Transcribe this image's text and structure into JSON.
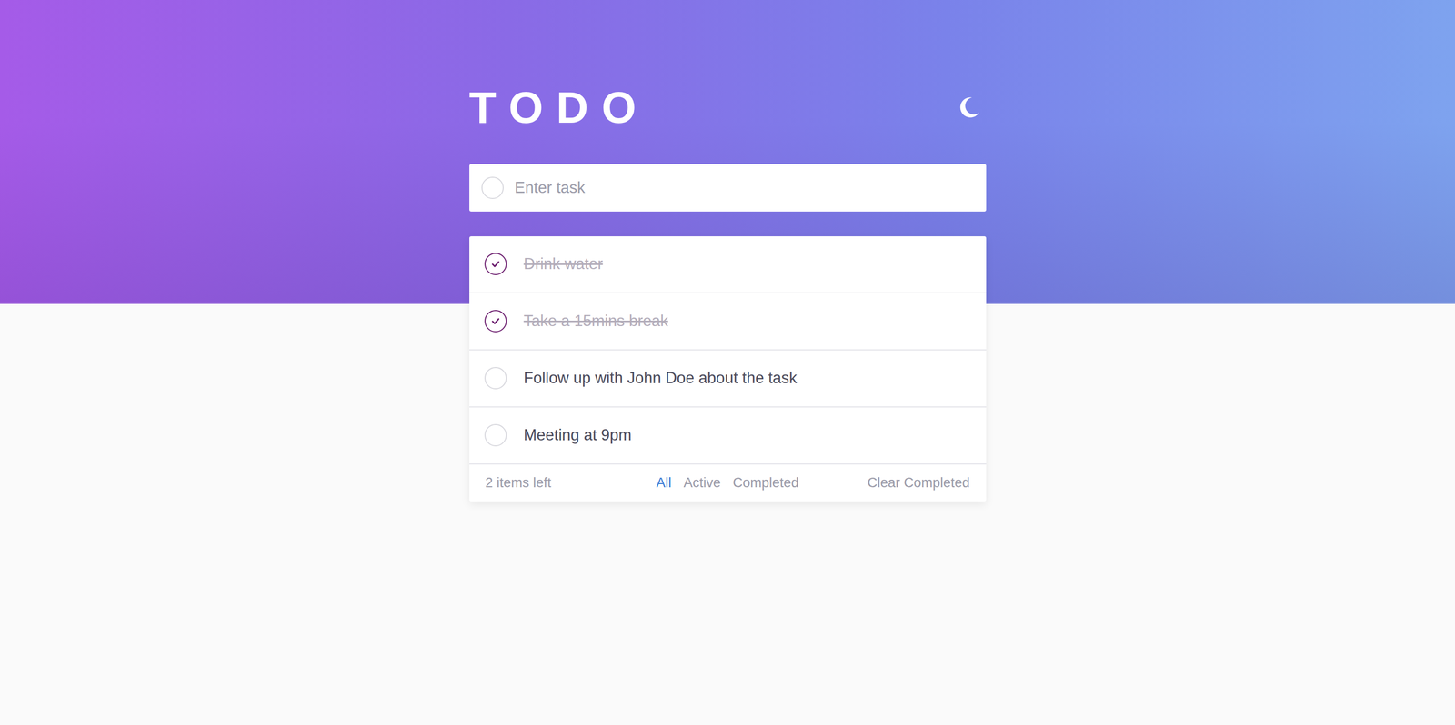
{
  "header": {
    "title": "TODO"
  },
  "new_task": {
    "placeholder": "Enter task",
    "value": ""
  },
  "todos": [
    {
      "text": "Drink water",
      "completed": true
    },
    {
      "text": "Take a 15mins break",
      "completed": true
    },
    {
      "text": "Follow up with John Doe about the task",
      "completed": false
    },
    {
      "text": "Meeting at 9pm",
      "completed": false
    }
  ],
  "footer": {
    "items_left": "2 items left",
    "filters": [
      {
        "label": "All",
        "selected": true
      },
      {
        "label": "Active",
        "selected": false
      },
      {
        "label": "Completed",
        "selected": false
      }
    ],
    "clear": "Clear Completed"
  }
}
